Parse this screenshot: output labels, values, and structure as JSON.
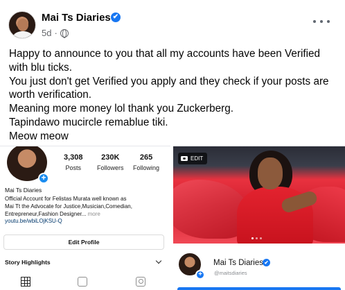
{
  "post": {
    "author": "Mai Ts Diaries",
    "verified_mark": "✔",
    "time": "5d",
    "privacy_icon": "globe-icon",
    "more_icon": "more-horizontal-icon",
    "lines": [
      "Happy to announce to you that all my accounts have been Verified",
      "with blu ticks.",
      "You just don't get Verified you apply and they check if your posts are",
      "worth verification.",
      "Meaning more money lol thank you Zuckerberg.",
      "Tapindawo mucircle remablue tiki.",
      "Meow meow"
    ]
  },
  "instagram": {
    "stats": [
      {
        "value": "3,308",
        "label": "Posts"
      },
      {
        "value": "230K",
        "label": "Followers"
      },
      {
        "value": "265",
        "label": "Following"
      }
    ],
    "plus": "+",
    "name": "Mai Ts Diaries",
    "bio_lines": [
      "Official Account for Felistas Murata well known as",
      "Mai Tt the Advocate for Justice,Musician,Comedian,",
      "Entrepreneur,Fashion Designer..."
    ],
    "bio_more": "more",
    "link": "youtu.be/wbiLOjKSU-Q",
    "edit_profile": "Edit Profile",
    "highlights": "Story Highlights",
    "tab_icons": [
      "grid-icon",
      "igtv-icon",
      "tagged-icon"
    ]
  },
  "facebook_page": {
    "edit_label": "EDIT",
    "name": "Mai Ts Diaries",
    "verified_mark": "✔",
    "plus": "+",
    "handle": "@maitsdiaries",
    "accent": "#1877f2"
  }
}
